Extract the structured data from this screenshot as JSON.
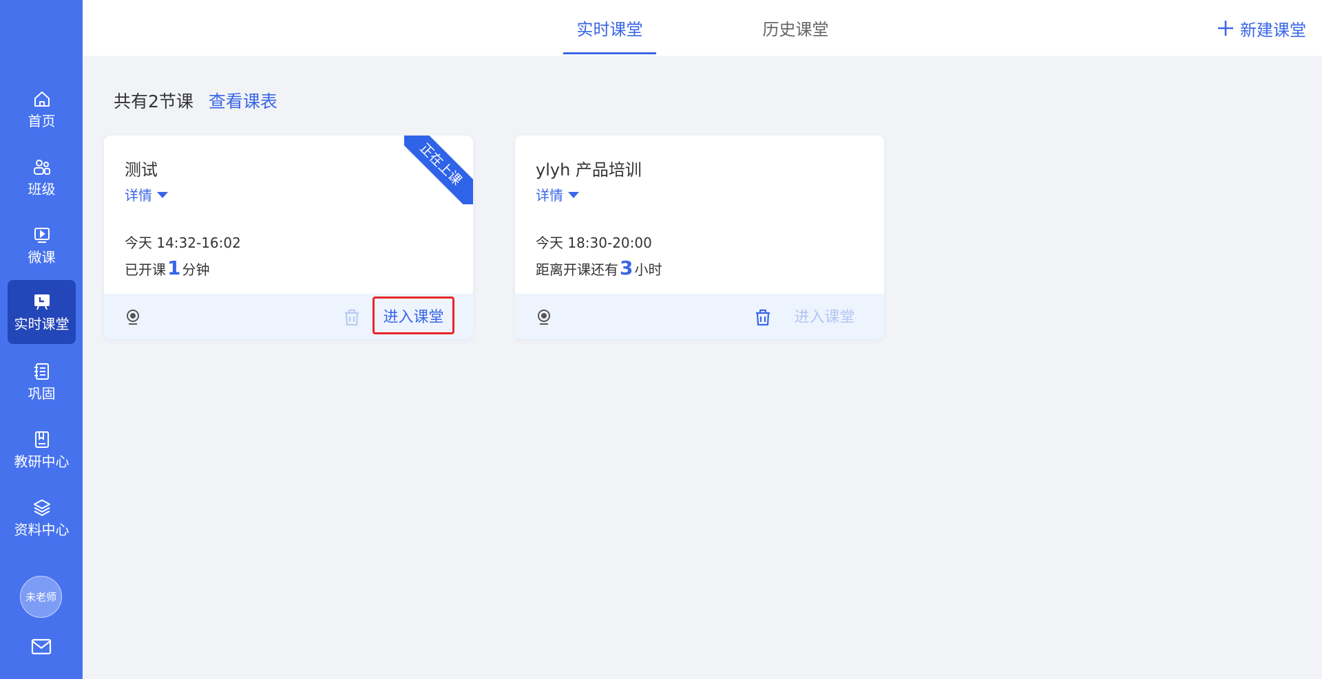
{
  "sidebar": {
    "items": [
      {
        "label": "首页",
        "icon": "home-icon"
      },
      {
        "label": "班级",
        "icon": "users-icon"
      },
      {
        "label": "微课",
        "icon": "video-icon"
      },
      {
        "label": "实时课堂",
        "icon": "live-class-icon"
      },
      {
        "label": "巩固",
        "icon": "notebook-icon"
      },
      {
        "label": "教研中心",
        "icon": "book-icon"
      },
      {
        "label": "资料中心",
        "icon": "layers-icon"
      }
    ],
    "active_index": 3,
    "avatar_label": "未老师",
    "mail_icon": "mail-icon"
  },
  "topbar": {
    "tabs": [
      {
        "label": "实时课堂",
        "active": true
      },
      {
        "label": "历史课堂",
        "active": false
      }
    ],
    "new_button": "新建课堂"
  },
  "summary": {
    "count_text": "共有2节课",
    "link_text": "查看课表"
  },
  "cards": [
    {
      "title": "测试",
      "details": "详情",
      "time": "今天 14:32-16:02",
      "status_prefix": "已开课",
      "status_num": "1",
      "status_suffix": "分钟",
      "ribbon": "正在上课",
      "enter": "进入课堂",
      "enter_enabled": true,
      "trash_enabled": false
    },
    {
      "title": "ylyh 产品培训",
      "details": "详情",
      "time": "今天 18:30-20:00",
      "status_prefix": "距离开课还有",
      "status_num": "3",
      "status_suffix": "小时",
      "enter": "进入课堂",
      "enter_enabled": false,
      "trash_enabled": true
    }
  ],
  "colors": {
    "sidebar": "#4672ee",
    "sidebar_active": "#2346b8",
    "accent": "#3a66e6",
    "highlight_border": "#e8262a"
  }
}
